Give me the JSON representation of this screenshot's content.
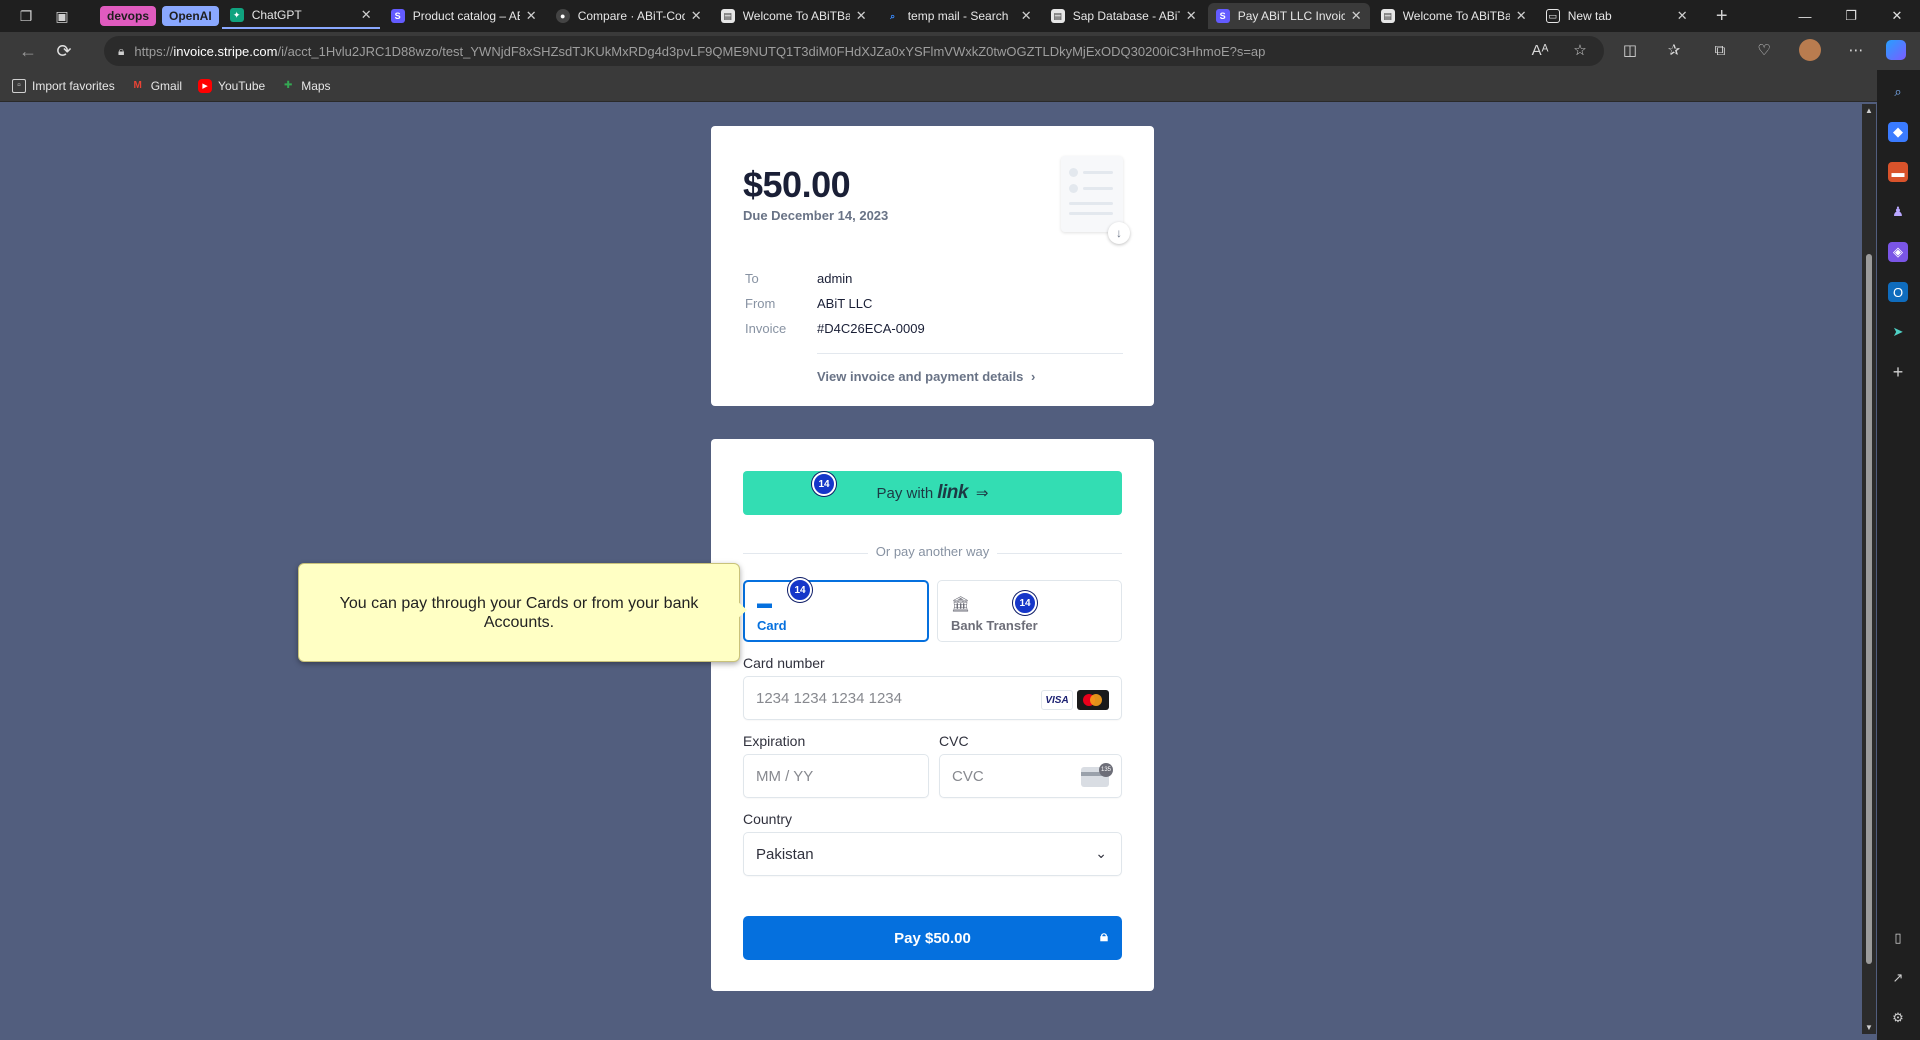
{
  "browser": {
    "tab_groups": [
      {
        "label": "devops",
        "bg": "#e05bbf",
        "fg": "#1f1f1f"
      },
      {
        "label": "OpenAI",
        "bg": "#8aa8ff",
        "fg": "#1f1f1f"
      }
    ],
    "tabs": [
      {
        "label": "ChatGPT",
        "favicon": "chatgpt-icon",
        "color": "#10a37f"
      },
      {
        "label": "Product catalog – ABiT",
        "favicon": "stripe-icon",
        "color": "#635bff"
      },
      {
        "label": "Compare · ABiT-Code",
        "favicon": "github-icon",
        "color": "#444444"
      },
      {
        "label": "Welcome To ABiTBank",
        "favicon": "page-icon",
        "color": "#e6e6e6"
      },
      {
        "label": "temp mail - Search",
        "favicon": "search-icon",
        "color": "#3a8cff"
      },
      {
        "label": "Sap Database - ABiT",
        "favicon": "page-icon",
        "color": "#e6e6e6"
      },
      {
        "label": "Pay ABiT LLC Invoice",
        "favicon": "stripe-icon",
        "color": "#635bff"
      },
      {
        "label": "Welcome To ABiTBank",
        "favicon": "page-icon",
        "color": "#e6e6e6"
      },
      {
        "label": "New tab",
        "favicon": "newtab-icon",
        "color": "#e6e6e6"
      }
    ],
    "url_prefix": "https://",
    "url_host": "invoice.stripe.com",
    "url_path": "/i/acct_1Hvlu2JRC1D88wzo/test_YWNjdF8xSHZsdTJKUkMxRDg4d3pvLF9QME9NUTQ1T3diM0FHdXJZa0xYSFlmVWxkZ0twOGZTLDkyMjExODQ30200iC3HhmoE?s=ap",
    "bookmarks": [
      {
        "label": "Import favorites",
        "icon": "import-icon",
        "color": "#d0d0d0"
      },
      {
        "label": "Gmail",
        "icon": "gmail-icon",
        "color": "#ea4335"
      },
      {
        "label": "YouTube",
        "icon": "youtube-icon",
        "color": "#ff0000"
      },
      {
        "label": "Maps",
        "icon": "maps-icon",
        "color": "#34a853"
      }
    ]
  },
  "invoice": {
    "amount": "$50.00",
    "due": "Due December 14, 2023",
    "meta": [
      {
        "key": "To",
        "value": "admin"
      },
      {
        "key": "From",
        "value": "ABiT LLC"
      },
      {
        "key": "Invoice",
        "value": "#D4C26ECA-0009"
      }
    ],
    "view_details": "View invoice and payment details",
    "view_details_chevron": "›"
  },
  "payment": {
    "link_prefix": "Pay with",
    "link_word": "link",
    "link_arrow": "⇒",
    "or_text": "Or pay another way",
    "methods": [
      {
        "label": "Card",
        "icon": "card-icon"
      },
      {
        "label": "Bank Transfer",
        "icon": "bank-icon"
      }
    ],
    "card_number_label": "Card number",
    "card_number_placeholder": "1234 1234 1234 1234",
    "card_brand_visa": "VISA",
    "expiration_label": "Expiration",
    "expiration_placeholder": "MM / YY",
    "cvc_label": "CVC",
    "cvc_placeholder": "CVC",
    "cvc_icon_number": "135",
    "country_label": "Country",
    "country_value": "Pakistan",
    "submit_label": "Pay $50.00"
  },
  "annotations": {
    "tooltip": "You can pay through your Cards or from your bank Accounts.",
    "badge_label": "14"
  },
  "colors": {
    "page_bg": "#525e7e",
    "link_green": "#33ddb3",
    "stripe_blue": "#0570de",
    "badge_blue": "#1536c9",
    "tooltip_yellow": "#ffffc4"
  }
}
